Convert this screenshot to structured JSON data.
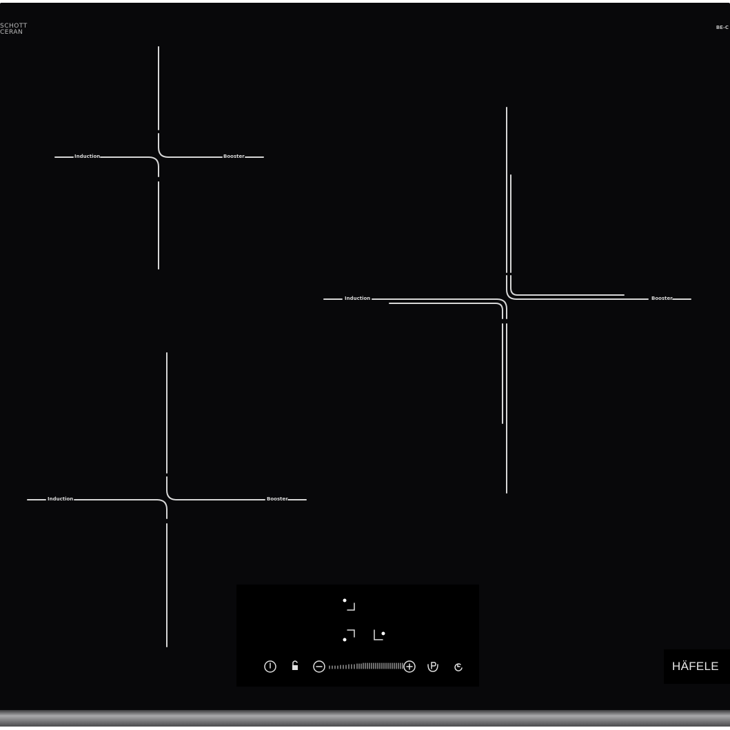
{
  "branding": {
    "glass_brand_line1": "SCHOTT",
    "glass_brand_line2": "CERAN",
    "corner_mark": "BE-C",
    "maker_logo": "HÄFELE"
  },
  "zones": [
    {
      "id": "top-left",
      "left_label": "Induction",
      "right_label": "Booster"
    },
    {
      "id": "right-large",
      "left_label": "Induction",
      "right_label": "Booster"
    },
    {
      "id": "bottom-left",
      "left_label": "Induction",
      "right_label": "Booster"
    }
  ],
  "controls": {
    "zone_selectors": [
      "zone-select-rear-right",
      "zone-select-front-left",
      "zone-select-front-right"
    ],
    "buttons": [
      "power",
      "lock",
      "minus",
      "slider",
      "plus",
      "pause",
      "timer"
    ]
  },
  "colors": {
    "glass": "#08080a",
    "markings": "#d8d8d8",
    "frame": "#a9a9ab"
  }
}
